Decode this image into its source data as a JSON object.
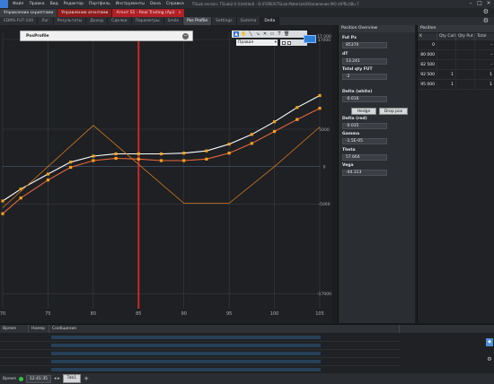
{
  "menubar": {
    "items": [
      "Файл",
      "Правка",
      "Вид",
      "Редактор",
      "Портфель",
      "Инструменты",
      "Окна",
      "Справка"
    ],
    "title": "TSLab version: TSLab2.0 (Untitled) - D:\\FOREX\\TSLab Materials\\Обновление MO (APRL)\\Bu.7"
  },
  "workspace_tabs": [
    {
      "label": "Управление скриптами",
      "style": "gray"
    },
    {
      "label": "Управление агентами",
      "style": "red"
    },
    {
      "label": "Агент S1 - Real Trading (Api)",
      "style": "red2",
      "close": "x"
    }
  ],
  "module_tabs": [
    {
      "label": "EDMS-FUT-100",
      "style": ""
    },
    {
      "label": "Лог",
      "style": ""
    },
    {
      "label": "Результаты",
      "style": ""
    },
    {
      "label": "Доход",
      "style": ""
    },
    {
      "label": "Сделки",
      "style": ""
    },
    {
      "label": "Параметры",
      "style": ""
    },
    {
      "label": "Smile",
      "style": ""
    },
    {
      "label": "Pos Profile",
      "style": "active"
    },
    {
      "label": "Settings",
      "style": ""
    },
    {
      "label": "Gamma",
      "style": ""
    },
    {
      "label": "Delta",
      "style": "dark"
    }
  ],
  "chart_panel": {
    "pane_title": "PosProfile",
    "select_value": "Правая",
    "x_ticks": [
      "70",
      "75",
      "80",
      "85",
      "90",
      "95",
      "100",
      "105"
    ],
    "y_ticks_right": [
      "17 000",
      "17000",
      "5000",
      "0",
      "-5000",
      "-17000"
    ]
  },
  "chart_data": {
    "type": "line",
    "title": "PosProfile",
    "xlabel": "",
    "ylabel": "",
    "xlim": [
      70,
      105
    ],
    "ylim": [
      -19000,
      17000
    ],
    "grid": true,
    "vertical_marker": 85,
    "series": [
      {
        "color": "#ffffff",
        "marker_color": "#f3a21a",
        "x": [
          70,
          72,
          75,
          77.5,
          80,
          82.5,
          85,
          87.5,
          90,
          92.5,
          95,
          97.5,
          100,
          102.5,
          105
        ],
        "y": [
          -4600,
          -3000,
          -1000,
          600,
          1400,
          1700,
          1700,
          1700,
          1800,
          2100,
          3000,
          4300,
          6000,
          7900,
          9500
        ]
      },
      {
        "color": "#e8673d",
        "marker_color": "#f3a21a",
        "x": [
          70,
          72,
          75,
          77.5,
          80,
          82.5,
          85,
          87.5,
          90,
          92.5,
          95,
          97.5,
          100,
          102.5,
          105
        ],
        "y": [
          -6300,
          -4200,
          -1800,
          -100,
          800,
          1100,
          1000,
          800,
          800,
          1000,
          1800,
          3100,
          4700,
          6300,
          7800
        ]
      },
      {
        "color": "#d47a1f",
        "x": [
          70,
          80,
          90,
          95,
          100,
          105
        ],
        "y": [
          -5500,
          5500,
          -4900,
          -4900,
          0,
          5300
        ]
      }
    ]
  },
  "overview": {
    "header": "Position Overview",
    "fields": [
      {
        "label": "Fut Px",
        "value": "85370"
      },
      {
        "label": "dT",
        "value": "13.241"
      },
      {
        "label": "Total qty FUT",
        "value": "-2"
      },
      {
        "label": "Delta (white)",
        "value": "-0.016"
      },
      {
        "label": "Delta (red)",
        "value": "-0.035"
      },
      {
        "label": "Gamma",
        "value": "-1.5E-05"
      },
      {
        "label": "Theta",
        "value": "57.664"
      },
      {
        "label": "Vega",
        "value": "-44.313"
      }
    ],
    "buttons": [
      "Hedge",
      "Drop pos"
    ]
  },
  "position_table": {
    "header": "Position",
    "columns": [
      "K",
      "Qty Call",
      "Qty Put",
      "Total"
    ],
    "rows": [
      [
        "0",
        "",
        "",
        "-"
      ],
      [
        "80 000",
        "",
        "",
        "-"
      ],
      [
        "82 500",
        "",
        "",
        "-"
      ],
      [
        "92 500",
        "1",
        "",
        "1"
      ],
      [
        "95 000",
        "1",
        "",
        "1"
      ]
    ]
  },
  "log": {
    "columns": [
      "Время",
      "Номер",
      "Сообщение"
    ]
  },
  "statusbar": {
    "label": "Время",
    "time": "12:41:35",
    "tab": "Tab1",
    "plus": "+"
  }
}
